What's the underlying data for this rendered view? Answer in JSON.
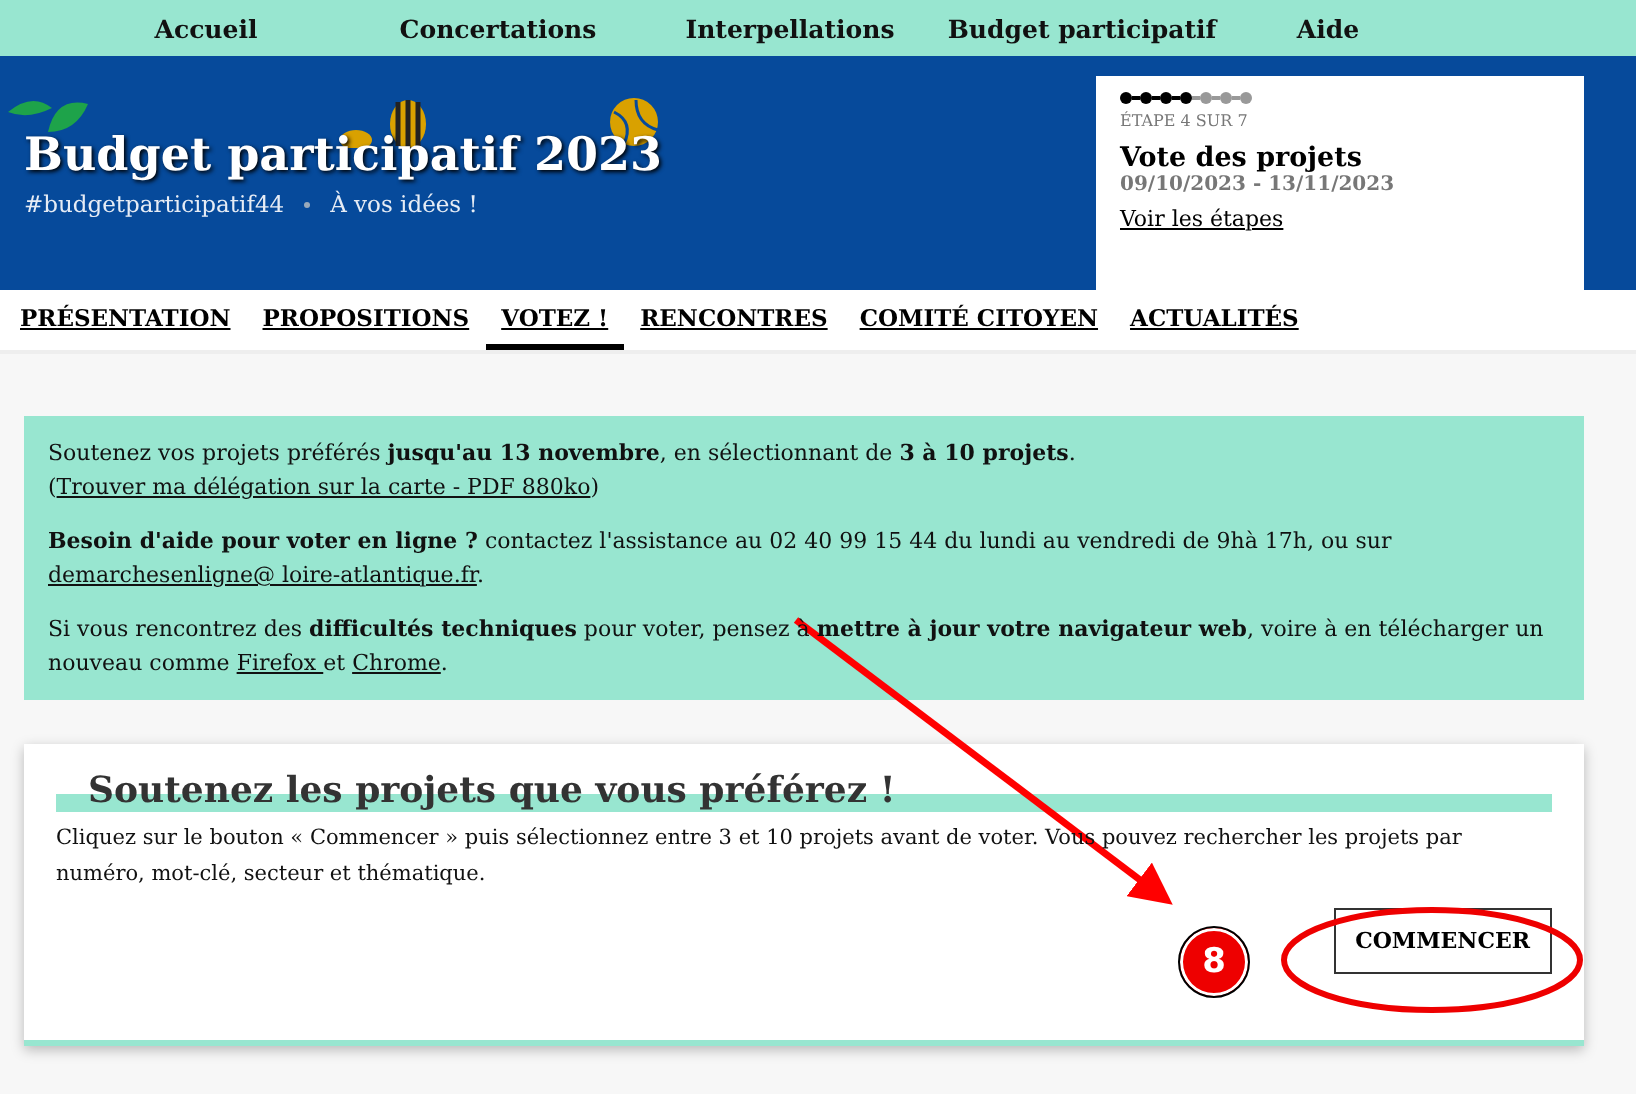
{
  "top_nav": [
    {
      "label": "Accueil"
    },
    {
      "label": "Concertations"
    },
    {
      "label": "Interpellations"
    },
    {
      "label": "Budget participatif"
    },
    {
      "label": "Aide"
    }
  ],
  "header": {
    "title": "Budget participatif 2023",
    "hashtag": "#budgetparticipatif44",
    "tagline": "À vos idées !",
    "step_card": {
      "dots": [
        {
          "done": true
        },
        {
          "done": true
        },
        {
          "done": true
        },
        {
          "done": true
        },
        {
          "done": false
        },
        {
          "done": false
        },
        {
          "done": false
        }
      ],
      "step_label": "ÉTAPE 4 SUR 7",
      "title": "Vote des projets",
      "dates": "09/10/2023 - 13/11/2023",
      "link": "Voir les étapes"
    }
  },
  "tabs": [
    {
      "label": "PRÉSENTATION",
      "selected": false
    },
    {
      "label": "PROPOSITIONS",
      "selected": false
    },
    {
      "label": "VOTEZ !",
      "selected": true
    },
    {
      "label": "RENCONTRES",
      "selected": false
    },
    {
      "label": "COMITÉ CITOYEN",
      "selected": false
    },
    {
      "label": "ACTUALITÉS",
      "selected": false
    }
  ],
  "info_box": {
    "paragraphs": [
      [
        {
          "kind": "text",
          "text": "Soutenez vos projets préférés **jusqu'au 13 novembre**, en sélectionnant de **3 à 10 projets**. ("
        },
        {
          "kind": "link",
          "text": "Trouver ma délégation sur la carte - PDF 880ko"
        },
        {
          "kind": "text",
          "text": ")"
        }
      ],
      [
        {
          "kind": "text",
          "text": "**Besoin d'aide pour voter en ligne ?** contactez l'assistance au 02 40 99 15 44 du lundi au vendredi de 9hà 17h, ou sur "
        },
        {
          "kind": "link",
          "text": "demarchesenligne@ loire-atlantique.fr"
        },
        {
          "kind": "text",
          "text": "."
        }
      ],
      [
        {
          "kind": "text",
          "text": "Si vous rencontrez des **difficultés techniques** pour voter, pensez à **mettre à jour votre navigateur web**, voire à en télécharger un nouveau comme "
        },
        {
          "kind": "link",
          "text": "Firefox "
        },
        {
          "kind": "text",
          "text": " et "
        },
        {
          "kind": "link",
          "text": "Chrome"
        },
        {
          "kind": "text",
          "text": "."
        }
      ]
    ]
  },
  "card": {
    "heading": "Soutenez les projets que vous préférez !",
    "text": "Cliquez sur le bouton « Commencer » puis sélectionnez entre 3 et 10 projets avant de voter. Vous pouvez rechercher les projets par numéro, mot-clé, secteur et thématique.",
    "button": "COMMENCER"
  },
  "annotation": {
    "badge": "8"
  }
}
